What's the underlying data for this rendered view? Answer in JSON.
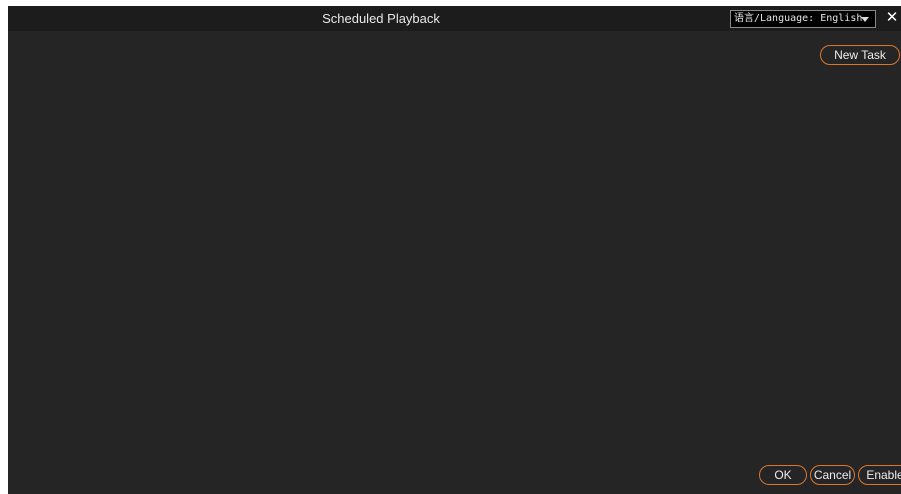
{
  "window": {
    "title": "Scheduled Playback"
  },
  "language_select": {
    "value": "语言/Language: English"
  },
  "close": {
    "glyph": "✕",
    "icon": "close-icon"
  },
  "toolbar": {
    "new_task_label": "New Task"
  },
  "footer": {
    "ok_label": "OK",
    "cancel_label": "Cancel",
    "enable_label": "Enable"
  },
  "colors": {
    "background": "#252525",
    "titlebar": "#1c1c1c",
    "accent_border": "#d8782f",
    "text": "#ececec"
  }
}
